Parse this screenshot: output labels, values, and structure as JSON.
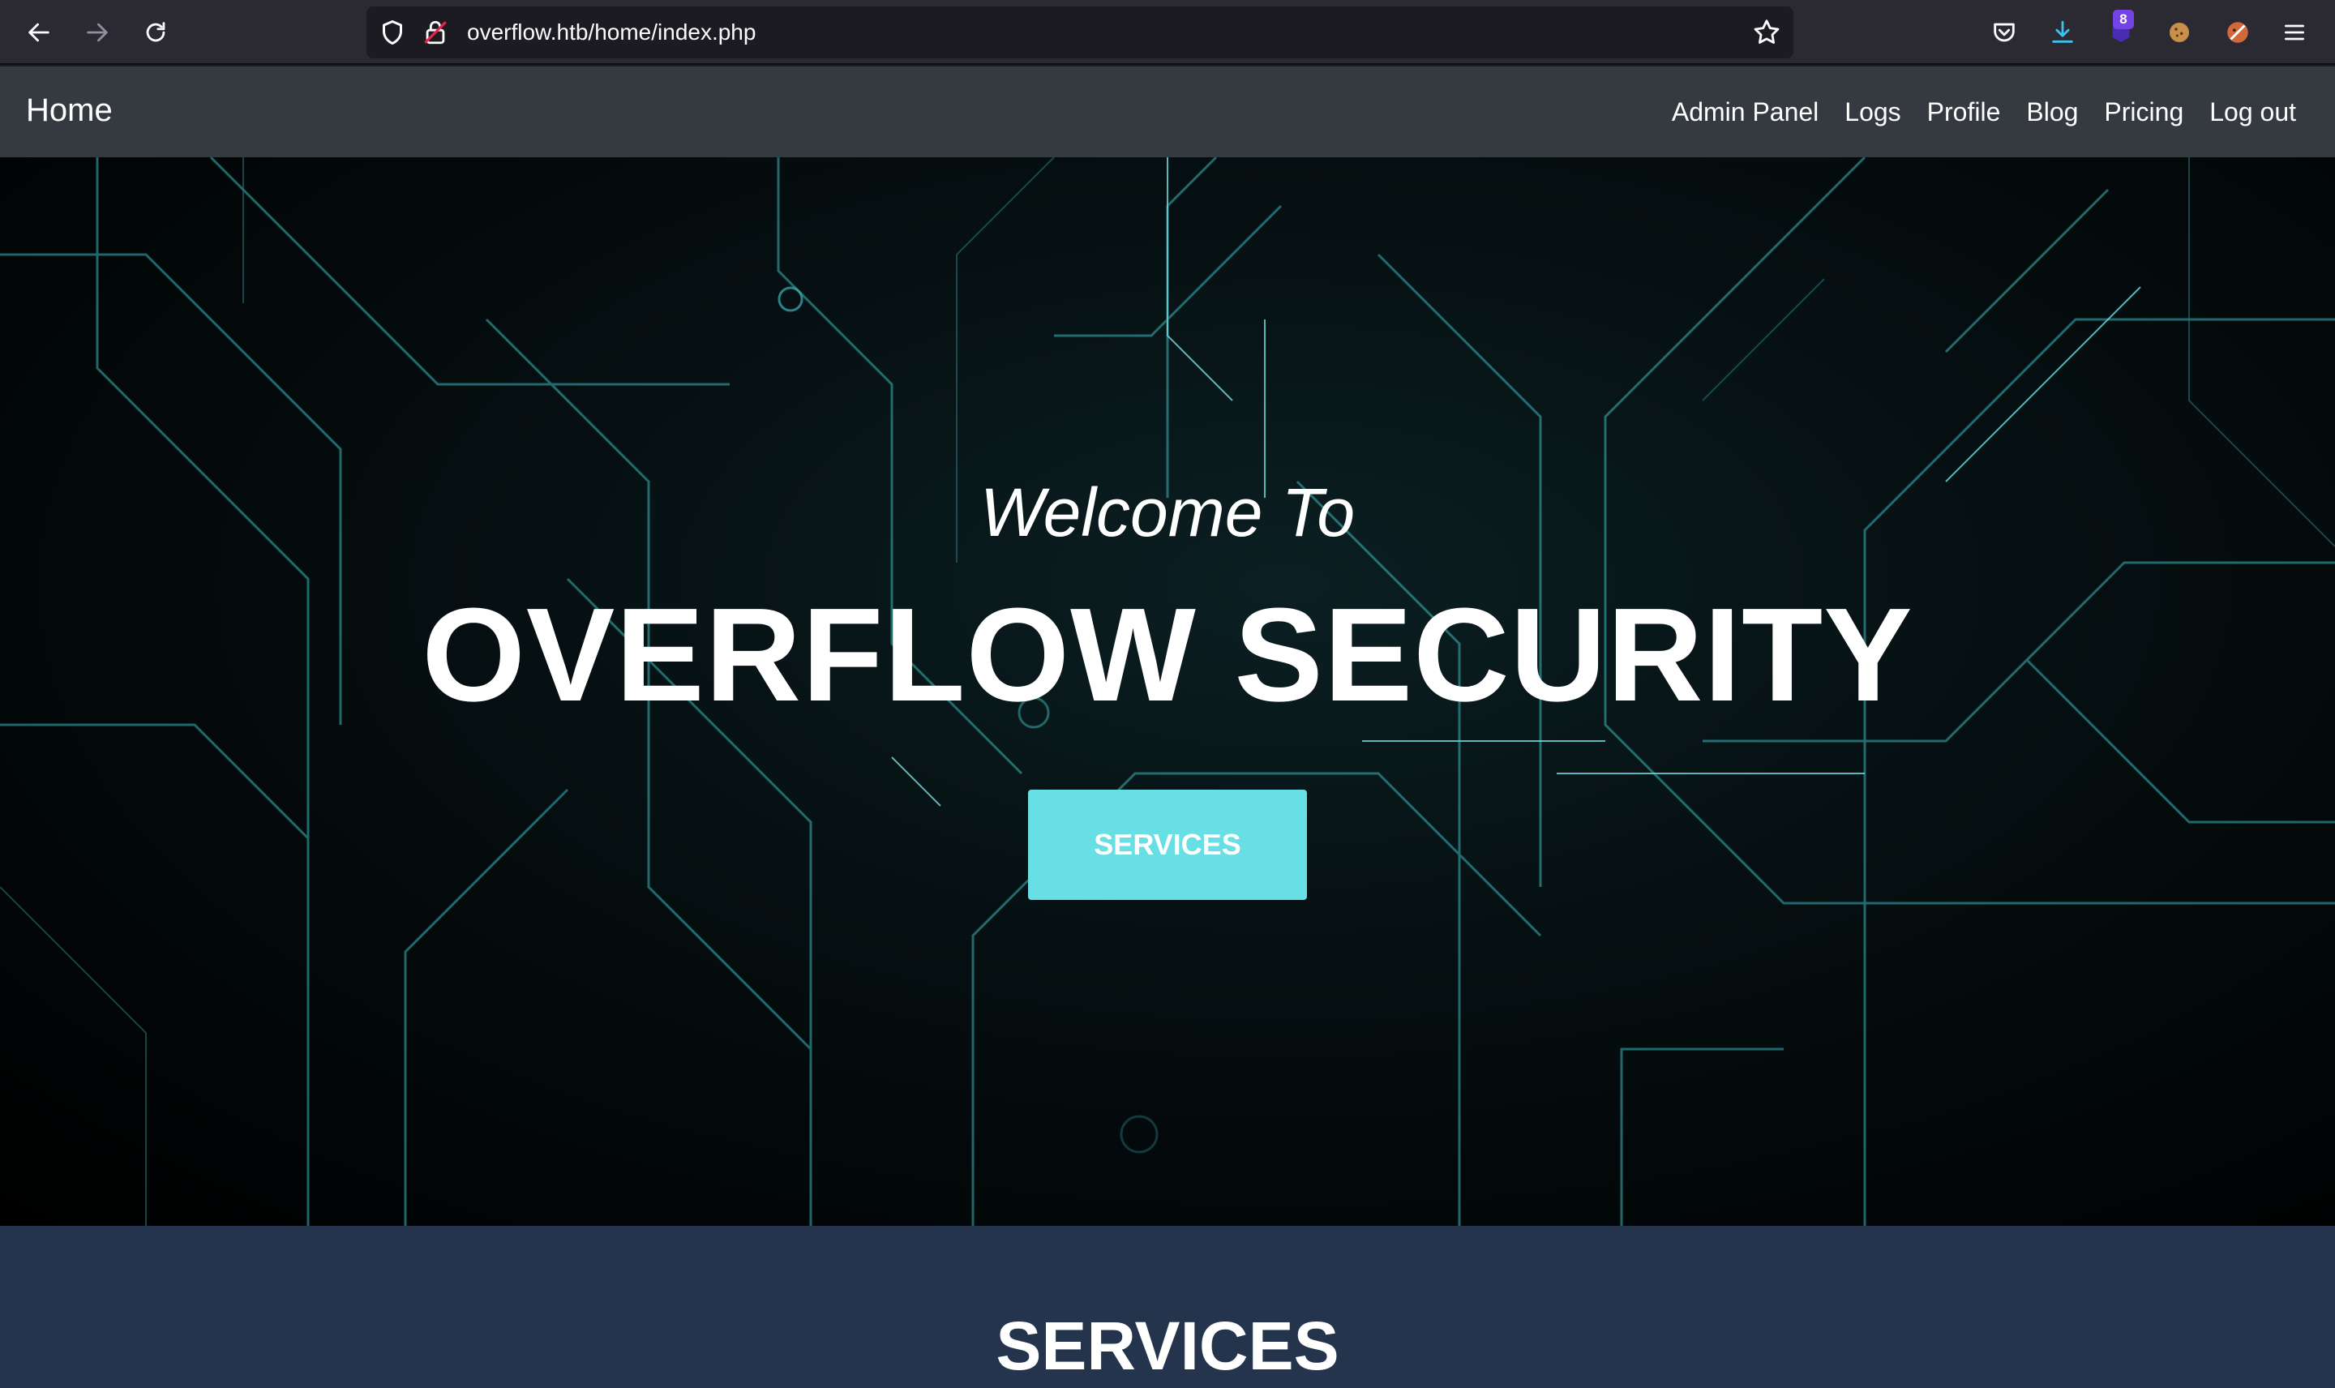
{
  "browser": {
    "url": "overflow.htb/home/index.php",
    "extension_badge": "8"
  },
  "navbar": {
    "brand": "Home",
    "links": [
      "Admin Panel",
      "Logs",
      "Profile",
      "Blog",
      "Pricing",
      "Log out"
    ]
  },
  "hero": {
    "welcome": "Welcome To",
    "title": "OVERFLOW SECURITY",
    "button": "SERVICES"
  },
  "services": {
    "heading": "SERVICES"
  },
  "colors": {
    "accent": "#68dfe5",
    "navbar": "#343a40",
    "section": "#25344d"
  }
}
